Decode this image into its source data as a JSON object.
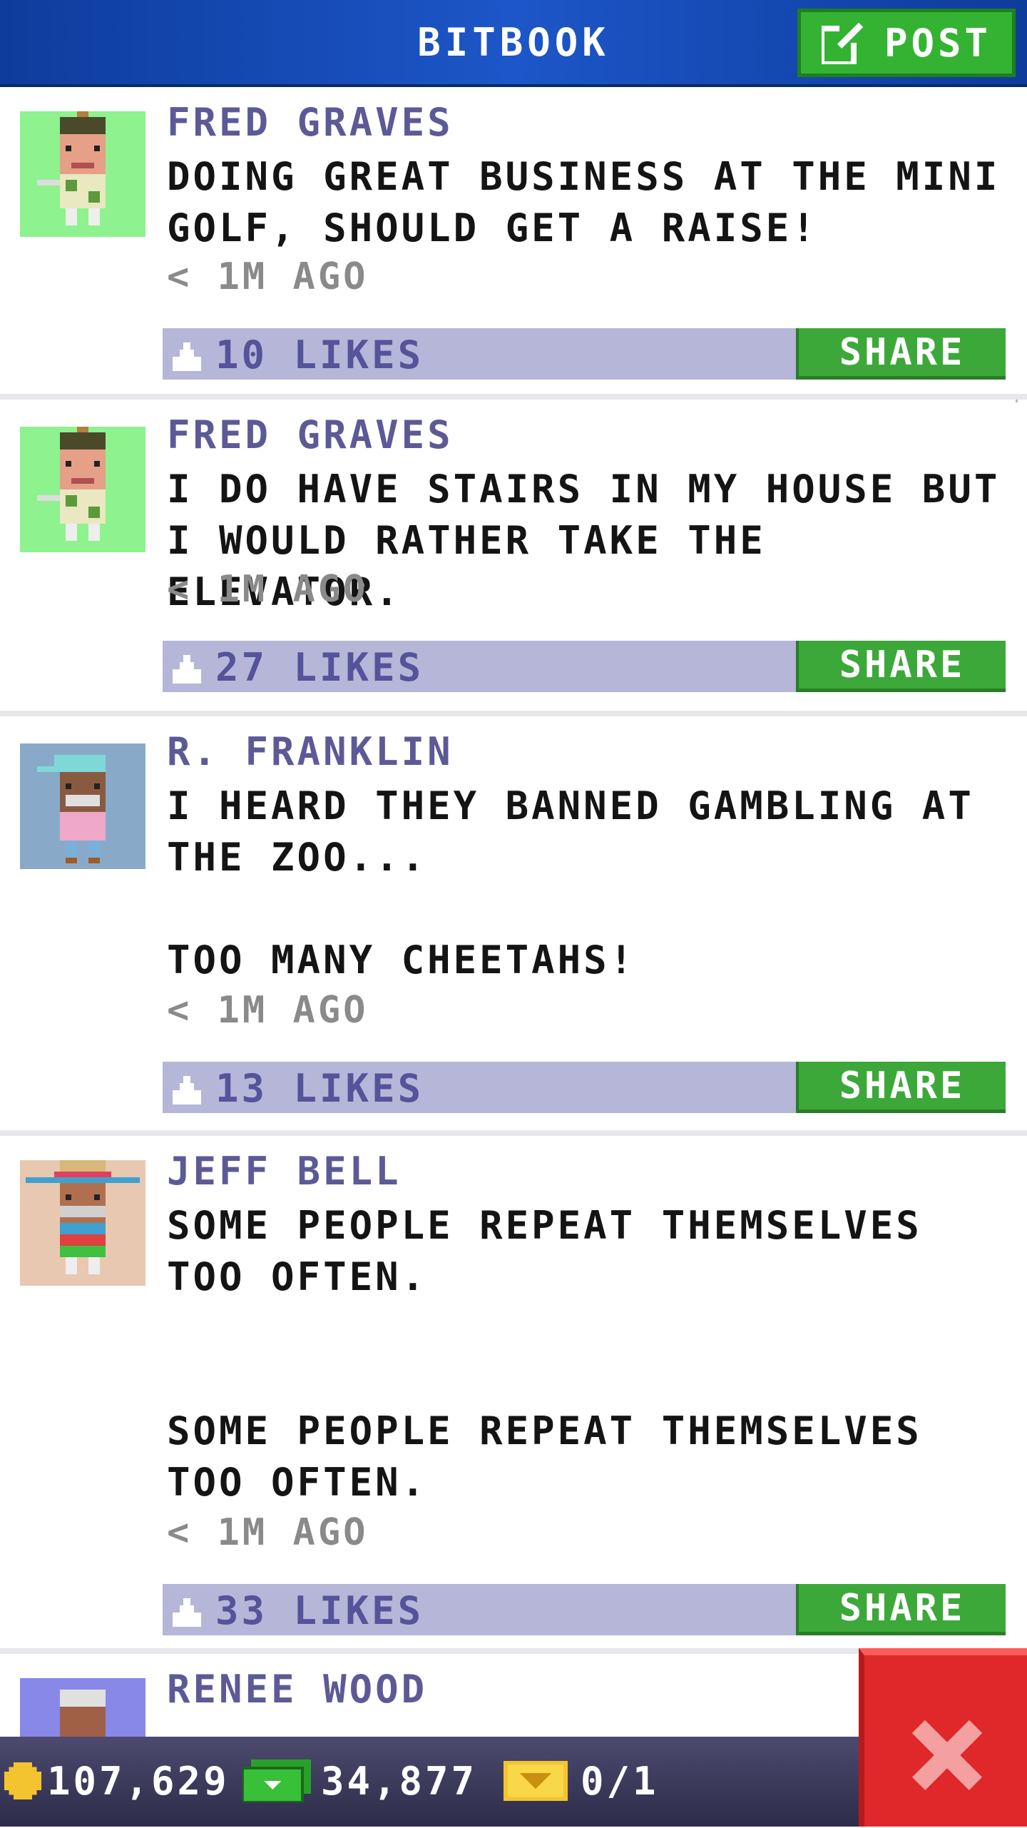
{
  "header": {
    "title": "BITBOOK",
    "post_label": "POST"
  },
  "posts": [
    {
      "author": "FRED GRAVES",
      "text": "DOING GREAT BUSINESS AT THE MINI GOLF, SHOULD GET A RAISE!",
      "time": "< 1M AGO",
      "likes": "10 LIKES",
      "share_label": "SHARE",
      "avatar": "golfer-avatar"
    },
    {
      "author": "FRED GRAVES",
      "text": "I DO HAVE STAIRS IN MY HOUSE BUT I WOULD RATHER TAKE THE ELEVATOR.",
      "time": "< 1M AGO",
      "likes": "27 LIKES",
      "share_label": "SHARE",
      "avatar": "golfer-avatar"
    },
    {
      "author": "R. FRANKLIN",
      "text": "I HEARD THEY BANNED GAMBLING AT THE ZOO...\n\nTOO MANY CHEETAHS!",
      "time": "< 1M AGO",
      "likes": "13 LIKES",
      "share_label": "SHARE",
      "avatar": "cap-avatar"
    },
    {
      "author": "JEFF BELL",
      "text": "SOME PEOPLE REPEAT THEMSELVES TOO OFTEN.\n\n\nSOME PEOPLE REPEAT THEMSELVES TOO OFTEN.",
      "time": "< 1M AGO",
      "likes": "33 LIKES",
      "share_label": "SHARE",
      "avatar": "sombrero-avatar"
    },
    {
      "author": "RENEE WOOD",
      "avatar": "elder-avatar"
    }
  ],
  "bottom_bar": {
    "coins": "107,629",
    "bux": "34,877",
    "tickets": "0/1"
  },
  "colors": {
    "header": "#1d56c8",
    "post_button": "#34b333",
    "share_button": "#3da83a",
    "like_bar": "#b6b6d8",
    "author": "#5c5a96",
    "close_button": "#e0282a"
  }
}
